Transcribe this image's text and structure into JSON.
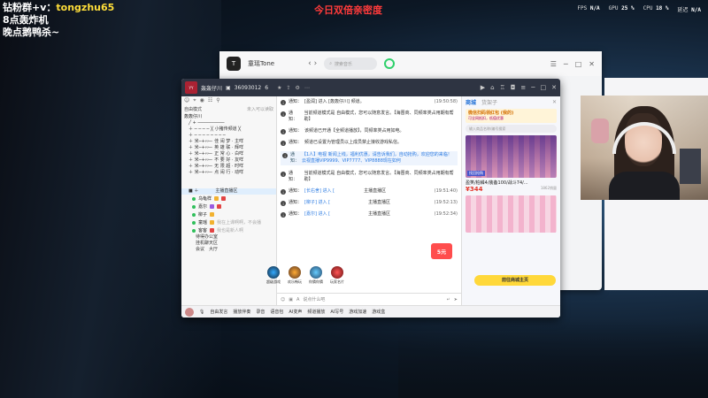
{
  "overlay": {
    "line1_prefix": "钻粉群+v：",
    "line1_handle": "tongzhu65",
    "line2": "8点轰炸机",
    "line3": "晚点鹅鸭杀~",
    "banner": "今日双倍亲密度"
  },
  "stats": {
    "fps_label": "FPS",
    "fps_val": "N/A",
    "gpu_label": "GPU",
    "gpu_val": "25 %",
    "cpu_label": "CPU",
    "cpu_val": "18 %",
    "lat_label": "延迟",
    "lat_val": "N/A"
  },
  "music": {
    "logo": "T",
    "title": "童瑶Tone",
    "search_placeholder": "搜索音乐"
  },
  "chat_window": {
    "room_name": "轰轰仔川",
    "room_id": "36093012",
    "user_count": "6",
    "left": {
      "mode_label": "自由模式",
      "mode_right": "未入可以读取",
      "channel": "轰轰仔川",
      "rows": [
        "╱ + ──────────",
        "＋ ─ ─ ─ ─ ╳ 小猪传频道 ╳",
        "＋ ─ ─ ─ ─ ─ ─ ─ ─",
        "＋ 米─+∾─· 佳  闹  梦  · 主咩",
        "＋ 米─+∾─· 英  雄  联  · 辉咩",
        "＋ 米─+∾─· 正  常  心  · 白咩",
        "＋ 米─+∾─· 不  要  好  · 友咩",
        "＋ 米─+∾─· 无  限  超  · 时咩",
        "＋ 米─+∾─· 点  闹  行  · 动咩"
      ],
      "hall": "主播直播区",
      "users": [
        {
          "name": "乌龟样",
          "extra": ""
        },
        {
          "name": "嘉尔",
          "extra": ""
        },
        {
          "name": "柳子",
          "extra": ""
        },
        {
          "name": "童瑶",
          "extra": "我在上课啊啊，不会播"
        },
        {
          "name": "客客",
          "extra": "我也是新人啊"
        }
      ],
      "tail_rows": [
        "待得办公室",
        "挂机聊天区",
        "会议　大厅"
      ]
    },
    "messages": [
      {
        "tag": "通知：",
        "text": "[盈润] 进入 [轰轰仔川] 频道。",
        "ts": "(19:50:58)",
        "type": "msg"
      },
      {
        "tag": "通知：",
        "text": "当前频道模式是 自由模式，您可以随意发言。【海晋商、同频率类占用期有帮助】",
        "ts": "",
        "type": "msg"
      },
      {
        "tag": "通知：",
        "text": "该频道已开通【全频道播放】，同频率类占用如电。",
        "ts": "",
        "type": "msg"
      },
      {
        "tag": "通知：",
        "text": "频道已设置为管理员以上成员禁止接收游戏私信。",
        "ts": "",
        "type": "msg"
      },
      {
        "tag": "通知：",
        "text": "【1人】电视 新闻上线，福利优惠，请告诉我们，自动抢购，欢迎您的来临！云视直播VIP9999、VIP7777、VIP8888现在如何",
        "ts": "",
        "type": "notice"
      },
      {
        "tag": "通知：",
        "text": "当前频道模式是 自由模式，您可以随意发言。【海晋商、同频率类占用期有帮助】",
        "ts": "",
        "type": "msg"
      },
      {
        "tag": "通知：",
        "text": "[长右舍] 进入 [",
        "ts": "(19:51:40)",
        "type": "msg"
      },
      {
        "tag": "通知：",
        "text": "[柳子] 进入 [",
        "ts": "(19:52:13)",
        "type": "msg"
      },
      {
        "tag": "通知：",
        "text": "[嘉尔] 进入 [",
        "ts": "(19:52:34)",
        "type": "msg"
      }
    ],
    "channel_suffix": "主播直播区",
    "gifts": [
      "超级游戏",
      "欢乐畅玩",
      "你猜你猜",
      "玩家名片"
    ],
    "red_pack": "5元",
    "input_placeholder": "说点什么吧",
    "shop": {
      "tab_active": "商城",
      "tab2": "货架子",
      "coupon_title": "微信扫码领红包 (我的)",
      "coupon_sub": "可全网抵扣，低值优惠",
      "search_placeholder": "输入商品名称/编号搜索",
      "item1_tag": "找回抢购",
      "item1_name": "盈笑/柏鳞4/装备100/战斗74/...",
      "item1_price": "¥344",
      "item1_sold": "1862销量",
      "button": "前往商城主页"
    },
    "status": [
      "自由发言",
      "播放伴奏",
      "录音",
      "语音包",
      "AI变声",
      "频道播放",
      "AI写号",
      "游戏加速",
      "游戏盒"
    ]
  },
  "colors": {
    "banner_red": "#ff3b3b",
    "handle_gold": "#ffde3a",
    "accent_blue": "#1f6fd6",
    "price_red": "#e3362b",
    "button_yellow": "#ffd83a",
    "titlebar": "#2e3442"
  }
}
